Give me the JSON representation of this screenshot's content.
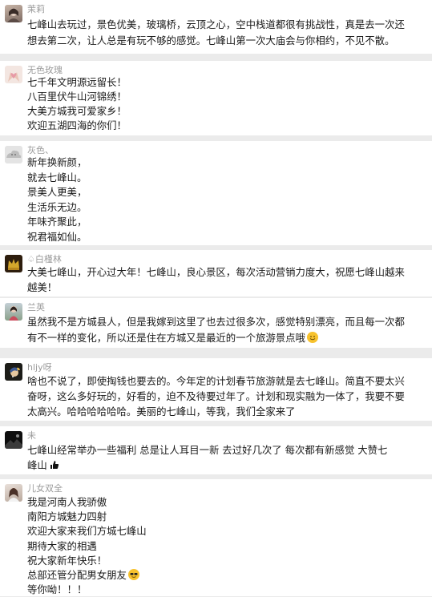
{
  "comments": [
    {
      "username": "茉莉",
      "avatar_icon": "woman-portrait-avatar",
      "lines": [
        "七峰山去玩过，景色优美，玻璃桥，云顶之心，空中栈道都很有挑战性，真是去一次还",
        "想去第二次，让人总是有玩不够的感觉。七峰山第一次大庙会与你相约，不见不散。"
      ]
    },
    {
      "username": "无色玫瑰",
      "avatar_icon": "hands-heart-avatar",
      "lines": [
        "七千年文明源远留长！",
        "八百里伏牛山河锦绣！",
        "大美方城我可爱家乡！",
        "欢迎五湖四海的你们！"
      ]
    },
    {
      "username": "灰色、",
      "avatar_icon": "default-gray-avatar",
      "lines": [
        "新年换新颜，",
        "就去七峰山。",
        "景美人更美，",
        "生活乐无边。",
        "年味齐聚此，",
        "祝君福如仙。"
      ]
    },
    {
      "username": "♤白槿林",
      "avatar_icon": "golden-crown-avatar",
      "lines": [
        "大美七峰山，开心过大年！七峰山，良心景区，每次活动营销力度大，祝愿七峰山越来",
        "越美！"
      ]
    },
    {
      "username": "兰英",
      "avatar_icon": "woman-outdoor-avatar",
      "lines": [
        "虽然我不是方城县人，但是我嫁到这里了也去过很多次，感觉特别漂亮，而且每一次都",
        "有不一样的变化，所以还是住在方城又是最近的一个旅游景点哦"
      ],
      "trailing_emoji": "smile-emoji"
    },
    {
      "username": "hljy呀",
      "avatar_icon": "pearl-earring-girl-avatar",
      "lines": [
        "啥也不说了，即使掏钱也要去的。今年定的计划春节旅游就是去七峰山。简直不要太兴",
        "奋呀，这么多好玩的，好看的，迫不及待要过年了。计划和现实融为一体了，我要不要",
        "太高兴。哈哈哈哈哈哈。美丽的七峰山，等我，我们全家来了"
      ]
    },
    {
      "username": "未",
      "avatar_icon": "dark-landscape-avatar",
      "lines": [
        "七峰山经常举办一些福利  总是让人耳目一新  去过好几次了  每次都有新感觉  大赞七",
        "峰山"
      ],
      "trailing_emoji": "thumbs-up-emoji"
    },
    {
      "username": "儿女双全",
      "avatar_icon": "girl-portrait-avatar",
      "lines": [
        "我是河南人我骄傲",
        "南阳方城魅力四射",
        "欢迎大家来我们方城七峰山",
        "期待大家的相遇",
        "祝大家新年快乐！",
        "总部还管分配男女朋友",
        "等你呦！！！"
      ],
      "emoji_line_index": 5,
      "trailing_emoji": "sunglasses-emoji"
    }
  ]
}
